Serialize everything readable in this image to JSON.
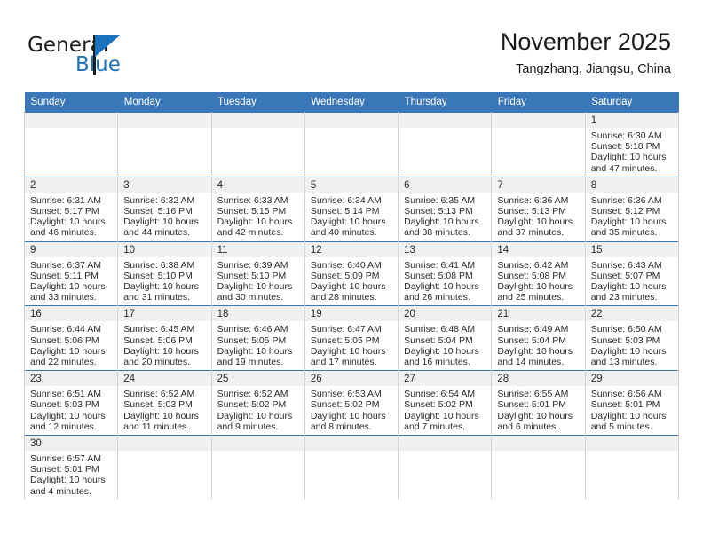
{
  "brand": {
    "name_part1": "General",
    "name_part2": "Blue",
    "logo_icon": "triangle-flag-icon"
  },
  "header": {
    "month_title": "November 2025",
    "location": "Tangzhang, Jiangsu, China"
  },
  "colors": {
    "header_blue": "#3a77b8",
    "brand_blue": "#1c72bd",
    "cell_strip_gray": "#f0f0f0",
    "cell_border_gray": "#d2d2d2"
  },
  "weekday_headers": [
    "Sunday",
    "Monday",
    "Tuesday",
    "Wednesday",
    "Thursday",
    "Friday",
    "Saturday"
  ],
  "labels": {
    "sunrise_prefix": "Sunrise:",
    "sunset_prefix": "Sunset:",
    "daylight_prefix": "Daylight:"
  },
  "weeks": [
    [
      {
        "day": "",
        "empty": true
      },
      {
        "day": "",
        "empty": true
      },
      {
        "day": "",
        "empty": true
      },
      {
        "day": "",
        "empty": true
      },
      {
        "day": "",
        "empty": true
      },
      {
        "day": "",
        "empty": true
      },
      {
        "day": "1",
        "sunrise": "Sunrise: 6:30 AM",
        "sunset": "Sunset: 5:18 PM",
        "daylight_l1": "Daylight: 10 hours",
        "daylight_l2": "and 47 minutes."
      }
    ],
    [
      {
        "day": "2",
        "sunrise": "Sunrise: 6:31 AM",
        "sunset": "Sunset: 5:17 PM",
        "daylight_l1": "Daylight: 10 hours",
        "daylight_l2": "and 46 minutes."
      },
      {
        "day": "3",
        "sunrise": "Sunrise: 6:32 AM",
        "sunset": "Sunset: 5:16 PM",
        "daylight_l1": "Daylight: 10 hours",
        "daylight_l2": "and 44 minutes."
      },
      {
        "day": "4",
        "sunrise": "Sunrise: 6:33 AM",
        "sunset": "Sunset: 5:15 PM",
        "daylight_l1": "Daylight: 10 hours",
        "daylight_l2": "and 42 minutes."
      },
      {
        "day": "5",
        "sunrise": "Sunrise: 6:34 AM",
        "sunset": "Sunset: 5:14 PM",
        "daylight_l1": "Daylight: 10 hours",
        "daylight_l2": "and 40 minutes."
      },
      {
        "day": "6",
        "sunrise": "Sunrise: 6:35 AM",
        "sunset": "Sunset: 5:13 PM",
        "daylight_l1": "Daylight: 10 hours",
        "daylight_l2": "and 38 minutes."
      },
      {
        "day": "7",
        "sunrise": "Sunrise: 6:36 AM",
        "sunset": "Sunset: 5:13 PM",
        "daylight_l1": "Daylight: 10 hours",
        "daylight_l2": "and 37 minutes."
      },
      {
        "day": "8",
        "sunrise": "Sunrise: 6:36 AM",
        "sunset": "Sunset: 5:12 PM",
        "daylight_l1": "Daylight: 10 hours",
        "daylight_l2": "and 35 minutes."
      }
    ],
    [
      {
        "day": "9",
        "sunrise": "Sunrise: 6:37 AM",
        "sunset": "Sunset: 5:11 PM",
        "daylight_l1": "Daylight: 10 hours",
        "daylight_l2": "and 33 minutes."
      },
      {
        "day": "10",
        "sunrise": "Sunrise: 6:38 AM",
        "sunset": "Sunset: 5:10 PM",
        "daylight_l1": "Daylight: 10 hours",
        "daylight_l2": "and 31 minutes."
      },
      {
        "day": "11",
        "sunrise": "Sunrise: 6:39 AM",
        "sunset": "Sunset: 5:10 PM",
        "daylight_l1": "Daylight: 10 hours",
        "daylight_l2": "and 30 minutes."
      },
      {
        "day": "12",
        "sunrise": "Sunrise: 6:40 AM",
        "sunset": "Sunset: 5:09 PM",
        "daylight_l1": "Daylight: 10 hours",
        "daylight_l2": "and 28 minutes."
      },
      {
        "day": "13",
        "sunrise": "Sunrise: 6:41 AM",
        "sunset": "Sunset: 5:08 PM",
        "daylight_l1": "Daylight: 10 hours",
        "daylight_l2": "and 26 minutes."
      },
      {
        "day": "14",
        "sunrise": "Sunrise: 6:42 AM",
        "sunset": "Sunset: 5:08 PM",
        "daylight_l1": "Daylight: 10 hours",
        "daylight_l2": "and 25 minutes."
      },
      {
        "day": "15",
        "sunrise": "Sunrise: 6:43 AM",
        "sunset": "Sunset: 5:07 PM",
        "daylight_l1": "Daylight: 10 hours",
        "daylight_l2": "and 23 minutes."
      }
    ],
    [
      {
        "day": "16",
        "sunrise": "Sunrise: 6:44 AM",
        "sunset": "Sunset: 5:06 PM",
        "daylight_l1": "Daylight: 10 hours",
        "daylight_l2": "and 22 minutes."
      },
      {
        "day": "17",
        "sunrise": "Sunrise: 6:45 AM",
        "sunset": "Sunset: 5:06 PM",
        "daylight_l1": "Daylight: 10 hours",
        "daylight_l2": "and 20 minutes."
      },
      {
        "day": "18",
        "sunrise": "Sunrise: 6:46 AM",
        "sunset": "Sunset: 5:05 PM",
        "daylight_l1": "Daylight: 10 hours",
        "daylight_l2": "and 19 minutes."
      },
      {
        "day": "19",
        "sunrise": "Sunrise: 6:47 AM",
        "sunset": "Sunset: 5:05 PM",
        "daylight_l1": "Daylight: 10 hours",
        "daylight_l2": "and 17 minutes."
      },
      {
        "day": "20",
        "sunrise": "Sunrise: 6:48 AM",
        "sunset": "Sunset: 5:04 PM",
        "daylight_l1": "Daylight: 10 hours",
        "daylight_l2": "and 16 minutes."
      },
      {
        "day": "21",
        "sunrise": "Sunrise: 6:49 AM",
        "sunset": "Sunset: 5:04 PM",
        "daylight_l1": "Daylight: 10 hours",
        "daylight_l2": "and 14 minutes."
      },
      {
        "day": "22",
        "sunrise": "Sunrise: 6:50 AM",
        "sunset": "Sunset: 5:03 PM",
        "daylight_l1": "Daylight: 10 hours",
        "daylight_l2": "and 13 minutes."
      }
    ],
    [
      {
        "day": "23",
        "sunrise": "Sunrise: 6:51 AM",
        "sunset": "Sunset: 5:03 PM",
        "daylight_l1": "Daylight: 10 hours",
        "daylight_l2": "and 12 minutes."
      },
      {
        "day": "24",
        "sunrise": "Sunrise: 6:52 AM",
        "sunset": "Sunset: 5:03 PM",
        "daylight_l1": "Daylight: 10 hours",
        "daylight_l2": "and 11 minutes."
      },
      {
        "day": "25",
        "sunrise": "Sunrise: 6:52 AM",
        "sunset": "Sunset: 5:02 PM",
        "daylight_l1": "Daylight: 10 hours",
        "daylight_l2": "and 9 minutes."
      },
      {
        "day": "26",
        "sunrise": "Sunrise: 6:53 AM",
        "sunset": "Sunset: 5:02 PM",
        "daylight_l1": "Daylight: 10 hours",
        "daylight_l2": "and 8 minutes."
      },
      {
        "day": "27",
        "sunrise": "Sunrise: 6:54 AM",
        "sunset": "Sunset: 5:02 PM",
        "daylight_l1": "Daylight: 10 hours",
        "daylight_l2": "and 7 minutes."
      },
      {
        "day": "28",
        "sunrise": "Sunrise: 6:55 AM",
        "sunset": "Sunset: 5:01 PM",
        "daylight_l1": "Daylight: 10 hours",
        "daylight_l2": "and 6 minutes."
      },
      {
        "day": "29",
        "sunrise": "Sunrise: 6:56 AM",
        "sunset": "Sunset: 5:01 PM",
        "daylight_l1": "Daylight: 10 hours",
        "daylight_l2": "and 5 minutes."
      }
    ],
    [
      {
        "day": "30",
        "sunrise": "Sunrise: 6:57 AM",
        "sunset": "Sunset: 5:01 PM",
        "daylight_l1": "Daylight: 10 hours",
        "daylight_l2": "and 4 minutes."
      },
      {
        "day": "",
        "empty": true
      },
      {
        "day": "",
        "empty": true
      },
      {
        "day": "",
        "empty": true
      },
      {
        "day": "",
        "empty": true
      },
      {
        "day": "",
        "empty": true
      },
      {
        "day": "",
        "empty": true
      }
    ]
  ]
}
